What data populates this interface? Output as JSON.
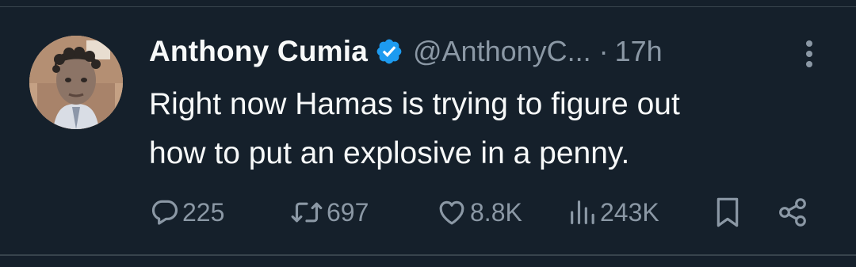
{
  "tweet": {
    "author": {
      "name": "Anthony Cumia",
      "handle": "@AnthonyC...",
      "verified": true
    },
    "separator": "·",
    "time": "17h",
    "lines": [
      "Right now Hamas is trying to figure out",
      "how to put an explosive in a penny."
    ],
    "stats": {
      "replies": "225",
      "retweets": "697",
      "likes": "8.8K",
      "views": "243K"
    }
  },
  "colors": {
    "background": "#15202b",
    "text": "#f7f9f9",
    "muted": "#8b98a5",
    "verified": "#1d9bf0",
    "divider": "#38444d"
  },
  "icons": [
    "verified-badge-icon",
    "more-options-icon",
    "reply-icon",
    "retweet-icon",
    "like-icon",
    "views-icon",
    "bookmark-icon",
    "share-icon"
  ]
}
